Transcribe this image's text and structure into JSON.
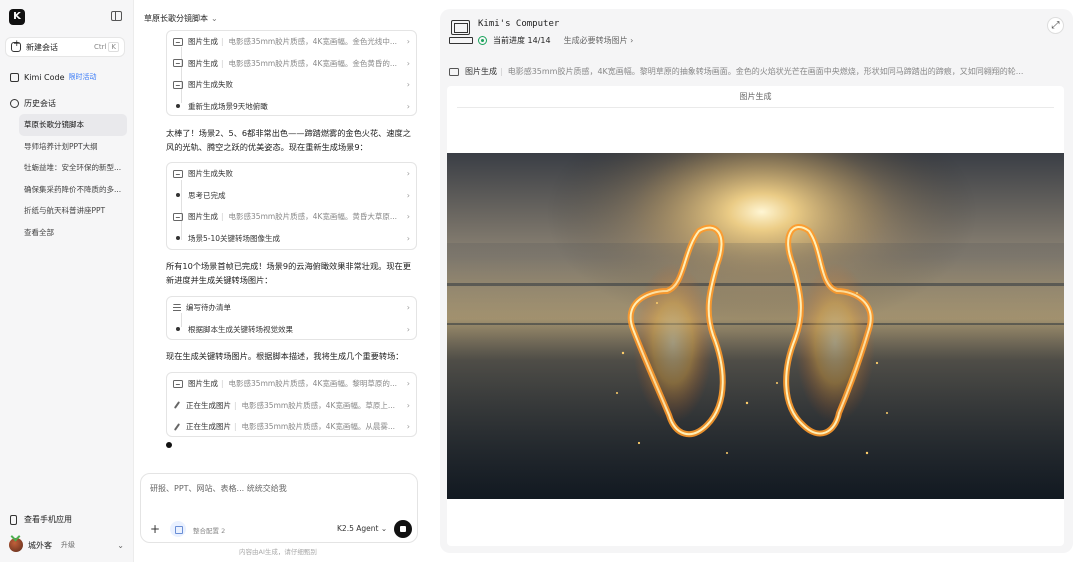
{
  "sidebar": {
    "logo_letter": "K",
    "new_chat": {
      "label": "新建会话",
      "shortcut_ctrl": "Ctrl",
      "shortcut_key": "K"
    },
    "kimi_code": {
      "label": "Kimi Code",
      "badge": "限时活动"
    },
    "history": {
      "title": "历史会话",
      "items": [
        {
          "label": "草原长歌分镜脚本",
          "active": true
        },
        {
          "label": "导师培养计划PPT大纲"
        },
        {
          "label": "牡蛎益堆：安全环保的新型..."
        },
        {
          "label": "确保集采药降价不降质的多..."
        },
        {
          "label": "折纸与航天科普讲座PPT"
        },
        {
          "label": "查看全部"
        }
      ]
    },
    "mobile_app": "查看手机应用",
    "user": {
      "name": "城外客",
      "upgrade": "升级"
    }
  },
  "chat": {
    "title": "草原长歌分镜脚本",
    "card1": [
      {
        "type": "img",
        "title": "图片生成",
        "desc": "电影感35mm胶片质感，4K宽画幅。金色光线中..."
      },
      {
        "type": "img",
        "title": "图片生成",
        "desc": "电影感35mm胶片质感，4K宽画幅。金色黄昏的..."
      },
      {
        "type": "img",
        "title": "图片生成失败",
        "desc": ""
      },
      {
        "type": "dot",
        "title": "重新生成场景9天地俯瞰",
        "desc": ""
      }
    ],
    "msg1": "太棒了！场景2、5、6都非常出色——蹄踏燃雾的金色火花、速度之风的光轨、腾空之跃的优美姿态。现在重新生成场景9：",
    "card2": [
      {
        "type": "img",
        "title": "图片生成失败",
        "desc": ""
      },
      {
        "type": "dot",
        "title": "思考已完成",
        "desc": ""
      },
      {
        "type": "img",
        "title": "图片生成",
        "desc": "电影感35mm胶片质感，4K宽画幅。黄昏大草原..."
      },
      {
        "type": "dot",
        "title": "场景5-10关键转场图像生成",
        "desc": ""
      }
    ],
    "msg2": "所有10个场景首帧已完成！场景9的云海俯瞰效果非常壮观。现在更新进度并生成关键转场图片：",
    "card3": [
      {
        "type": "list",
        "title": "编写待办清单",
        "desc": ""
      },
      {
        "type": "dot",
        "title": "根据脚本生成关键转场视觉效果",
        "desc": ""
      }
    ],
    "msg3": "现在生成关键转场图片。根据脚本描述，我将生成几个重要转场：",
    "card4": [
      {
        "type": "img",
        "title": "图片生成",
        "desc": "电影感35mm胶片质感，4K宽画幅。黎明草原的..."
      },
      {
        "type": "brush",
        "title": "正在生成图片",
        "desc": "电影感35mm胶片质感，4K宽画幅。草原上..."
      },
      {
        "type": "brush",
        "title": "正在生成图片",
        "desc": "电影感35mm胶片质感，4K宽画幅。从晨雾..."
      }
    ],
    "input_placeholder": "研报、PPT、网站、表格... 统统交给我",
    "tool_label": "整合配置 2",
    "agent_label": "K2.5 Agent",
    "disclaimer": "内容由AI生成，请仔细甄别"
  },
  "computer": {
    "title": "Kimi's Computer",
    "progress_label": "当前进度",
    "progress_value": "14/14",
    "step_link": "生成必要转场图片",
    "action_title": "图片生成",
    "action_desc": "电影感35mm胶片质感，4K宽画幅。黎明草原的抽象转场画面。金色的火焰状光芒在画面中央燃烧，形状如同马蹄踏出的蹄痕，又如同翱翔的轮...",
    "viewer_title": "图片生成"
  },
  "colors": {
    "sidebar_bg": "#f6f6f7",
    "panel_bg": "#f5f5f6",
    "accent_blue": "#3a7bf7",
    "status_green": "#1aa35b"
  }
}
